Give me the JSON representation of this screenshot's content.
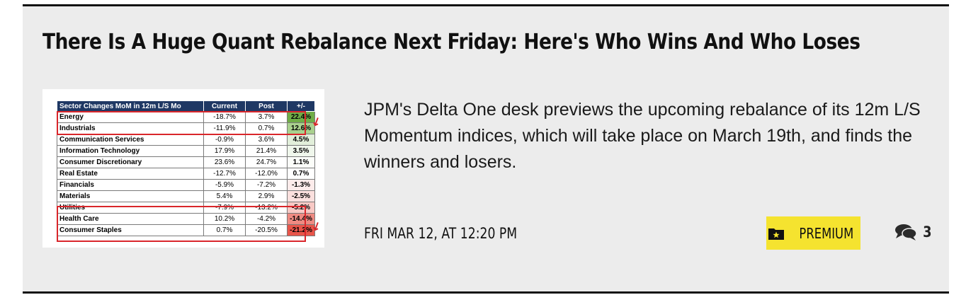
{
  "article": {
    "headline": "There Is A Huge Quant Rebalance Next Friday: Here's Who Wins And Who Loses",
    "summary": "JPM's Delta One desk previews the upcoming rebalance of its 12m L/S Momentum indices, which will take place on March 19th, and finds the winners and losers.",
    "dateline": "FRI MAR 12, AT 12:20 PM",
    "premium_label": "PREMIUM",
    "comment_count": "3",
    "thumbnail": {
      "headers": [
        "Sector Changes MoM in 12m L/S Mo",
        "Current",
        "Post",
        "+/-"
      ],
      "rows": [
        {
          "sector": "Energy",
          "current": "-18.7%",
          "post": "3.7%",
          "change": "22.4%",
          "color": "#70ad47"
        },
        {
          "sector": "Industrials",
          "current": "-11.9%",
          "post": "0.7%",
          "change": "12.6%",
          "color": "#a9d18e"
        },
        {
          "sector": "Communication Services",
          "current": "-0.9%",
          "post": "3.6%",
          "change": "4.5%",
          "color": "#e2efda"
        },
        {
          "sector": "Information Technology",
          "current": "17.9%",
          "post": "21.4%",
          "change": "3.5%",
          "color": "#f0f7ec"
        },
        {
          "sector": "Consumer Discretionary",
          "current": "23.6%",
          "post": "24.7%",
          "change": "1.1%",
          "color": "#fbfdf9"
        },
        {
          "sector": "Real Estate",
          "current": "-12.7%",
          "post": "-12.0%",
          "change": "0.7%",
          "color": "#ffffff"
        },
        {
          "sector": "Financials",
          "current": "-5.9%",
          "post": "-7.2%",
          "change": "-1.3%",
          "color": "#fdeceb"
        },
        {
          "sector": "Materials",
          "current": "5.4%",
          "post": "2.9%",
          "change": "-2.5%",
          "color": "#fbe0de"
        },
        {
          "sector": "Utilities",
          "current": "-7.9%",
          "post": "-13.2%",
          "change": "-5.2%",
          "color": "#f8c9c5"
        },
        {
          "sector": "Health Care",
          "current": "10.2%",
          "post": "-4.2%",
          "change": "-14.4%",
          "color": "#ee8a82"
        },
        {
          "sector": "Consumer Staples",
          "current": "0.7%",
          "post": "-20.5%",
          "change": "-21.2%",
          "color": "#e8554a"
        }
      ]
    }
  },
  "icons": {
    "premium": "folder-star-icon",
    "comments": "speech-bubbles-icon"
  },
  "colors": {
    "card_bg": "#ececec",
    "premium_bg": "#f5e32f",
    "highlight_red": "#d9262b",
    "table_header": "#1f3864"
  }
}
